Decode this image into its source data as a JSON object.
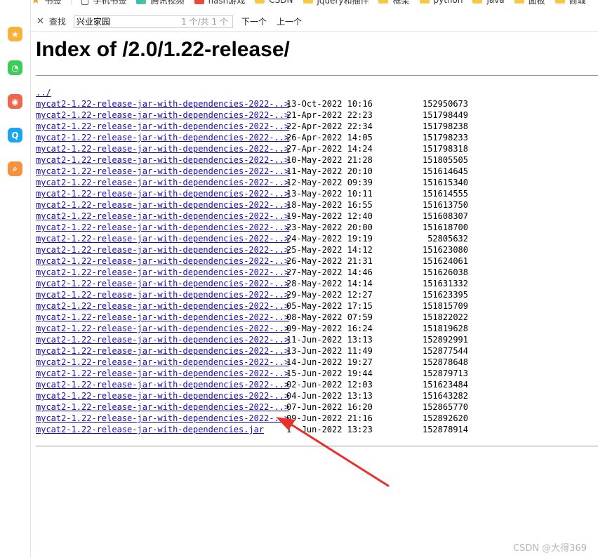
{
  "bookmarks": [
    {
      "icon": "star-icon",
      "label": "书签"
    },
    {
      "icon": "phone-icon",
      "label": "手机书签"
    },
    {
      "icon": "video-icon",
      "label": "腾讯视频"
    },
    {
      "icon": "game-icon",
      "label": "flash游戏"
    },
    {
      "icon": "folder-icon",
      "label": "CSDN"
    },
    {
      "icon": "folder-icon",
      "label": "jquery和插件"
    },
    {
      "icon": "folder-icon",
      "label": "框架"
    },
    {
      "icon": "folder-icon",
      "label": "python"
    },
    {
      "icon": "folder-icon",
      "label": "java"
    },
    {
      "icon": "folder-icon",
      "label": "面板"
    },
    {
      "icon": "folder-icon",
      "label": "商城"
    }
  ],
  "sidebar": {
    "icons": [
      {
        "name": "favorites-icon",
        "color": "#f7b23b"
      },
      {
        "name": "wechat-icon",
        "color": "#3dcc5a"
      },
      {
        "name": "weibo-icon",
        "color": "#f0664c"
      },
      {
        "name": "qq-icon",
        "color": "#1aa5f0"
      },
      {
        "name": "search-sidebar-icon",
        "color": "#f7913b"
      }
    ]
  },
  "findbar": {
    "close": "✕",
    "label": "查找",
    "value": "兴业家园",
    "count": "1 个/共 1 个",
    "next": "下一个",
    "prev": "上一个"
  },
  "page": {
    "title": "Index of /2.0/1.22-release/",
    "parent_link": "../",
    "rows": [
      {
        "name": "mycat2-1.22-release-jar-with-dependencies-2022-..>",
        "date": "13-Oct-2022 10:16",
        "size": "152950673"
      },
      {
        "name": "mycat2-1.22-release-jar-with-dependencies-2022-..>",
        "date": "21-Apr-2022 22:23",
        "size": "151798449"
      },
      {
        "name": "mycat2-1.22-release-jar-with-dependencies-2022-..>",
        "date": "22-Apr-2022 22:34",
        "size": "151798238"
      },
      {
        "name": "mycat2-1.22-release-jar-with-dependencies-2022-..>",
        "date": "26-Apr-2022 14:05",
        "size": "151798233"
      },
      {
        "name": "mycat2-1.22-release-jar-with-dependencies-2022-..>",
        "date": "27-Apr-2022 14:24",
        "size": "151798318"
      },
      {
        "name": "mycat2-1.22-release-jar-with-dependencies-2022-..>",
        "date": "10-May-2022 21:28",
        "size": "151805505"
      },
      {
        "name": "mycat2-1.22-release-jar-with-dependencies-2022-..>",
        "date": "11-May-2022 20:10",
        "size": "151614645"
      },
      {
        "name": "mycat2-1.22-release-jar-with-dependencies-2022-..>",
        "date": "12-May-2022 09:39",
        "size": "151615340"
      },
      {
        "name": "mycat2-1.22-release-jar-with-dependencies-2022-..>",
        "date": "13-May-2022 10:11",
        "size": "151614555"
      },
      {
        "name": "mycat2-1.22-release-jar-with-dependencies-2022-..>",
        "date": "18-May-2022 16:55",
        "size": "151613750"
      },
      {
        "name": "mycat2-1.22-release-jar-with-dependencies-2022-..>",
        "date": "19-May-2022 12:40",
        "size": "151608307"
      },
      {
        "name": "mycat2-1.22-release-jar-with-dependencies-2022-..>",
        "date": "23-May-2022 20:00",
        "size": "151618700"
      },
      {
        "name": "mycat2-1.22-release-jar-with-dependencies-2022-..>",
        "date": "24-May-2022 19:19",
        "size": "52805632"
      },
      {
        "name": "mycat2-1.22-release-jar-with-dependencies-2022-..>",
        "date": "25-May-2022 14:12",
        "size": "151623080"
      },
      {
        "name": "mycat2-1.22-release-jar-with-dependencies-2022-..>",
        "date": "26-May-2022 21:31",
        "size": "151624061"
      },
      {
        "name": "mycat2-1.22-release-jar-with-dependencies-2022-..>",
        "date": "27-May-2022 14:46",
        "size": "151626038"
      },
      {
        "name": "mycat2-1.22-release-jar-with-dependencies-2022-..>",
        "date": "28-May-2022 14:14",
        "size": "151631332"
      },
      {
        "name": "mycat2-1.22-release-jar-with-dependencies-2022-..>",
        "date": "29-May-2022 12:27",
        "size": "151623395"
      },
      {
        "name": "mycat2-1.22-release-jar-with-dependencies-2022-..>",
        "date": "05-May-2022 17:15",
        "size": "151815709"
      },
      {
        "name": "mycat2-1.22-release-jar-with-dependencies-2022-..>",
        "date": "08-May-2022 07:59",
        "size": "151822022"
      },
      {
        "name": "mycat2-1.22-release-jar-with-dependencies-2022-..>",
        "date": "09-May-2022 16:24",
        "size": "151819628"
      },
      {
        "name": "mycat2-1.22-release-jar-with-dependencies-2022-..>",
        "date": "11-Jun-2022 13:13",
        "size": "152892991"
      },
      {
        "name": "mycat2-1.22-release-jar-with-dependencies-2022-..>",
        "date": "13-Jun-2022 11:49",
        "size": "152877544"
      },
      {
        "name": "mycat2-1.22-release-jar-with-dependencies-2022-..>",
        "date": "14-Jun-2022 19:27",
        "size": "152878648"
      },
      {
        "name": "mycat2-1.22-release-jar-with-dependencies-2022-..>",
        "date": "15-Jun-2022 19:44",
        "size": "152879713"
      },
      {
        "name": "mycat2-1.22-release-jar-with-dependencies-2022-..>",
        "date": "02-Jun-2022 12:03",
        "size": "151623484"
      },
      {
        "name": "mycat2-1.22-release-jar-with-dependencies-2022-..>",
        "date": "04-Jun-2022 13:13",
        "size": "151643282"
      },
      {
        "name": "mycat2-1.22-release-jar-with-dependencies-2022-..>",
        "date": "07-Jun-2022 16:20",
        "size": "152865770"
      },
      {
        "name": "mycat2-1.22-release-jar-with-dependencies-2022-..>",
        "date": "09-Jun-2022 21:16",
        "size": "152892620"
      },
      {
        "name": "mycat2-1.22-release-jar-with-dependencies.jar",
        "date": "1 -Jun-2022 13:23",
        "size": "152878914"
      }
    ]
  },
  "annotation": {
    "arrow_color": "#e8312a"
  },
  "watermark": "CSDN @大得369"
}
